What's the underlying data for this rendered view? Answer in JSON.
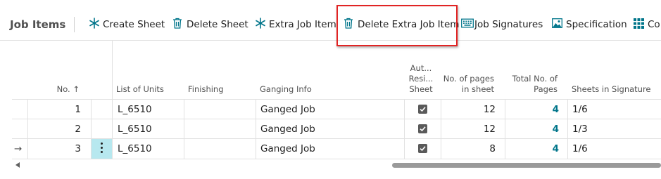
{
  "toolbar": {
    "title": "Job Items",
    "buttons": [
      {
        "label": "Create Sheet",
        "icon": "asterisk-icon"
      },
      {
        "label": "Delete Sheet",
        "icon": "trash-icon"
      },
      {
        "label": "Extra Job Item",
        "icon": "asterisk-icon"
      },
      {
        "label": "Delete Extra Job Item",
        "icon": "trash-icon"
      },
      {
        "label": "Job Signatures",
        "icon": "keyboard-icon"
      },
      {
        "label": "Specification",
        "icon": "image-icon"
      },
      {
        "label": "Co",
        "icon": "grid-icon"
      }
    ]
  },
  "table": {
    "headers": {
      "no": "No. ↑",
      "list_of_units": "List of Units",
      "finishing": "Finishing",
      "ganging_info": "Ganging Info",
      "auto_resize_1": "Aut...",
      "auto_resize_2": "Resi...",
      "auto_resize_3": "Sheet",
      "pages_in_sheet_1": "No. of pages",
      "pages_in_sheet_2": "in sheet",
      "total_pages_1": "Total No. of",
      "total_pages_2": "Pages",
      "sheets_in_signature": "Sheets in Signature"
    },
    "rows": [
      {
        "no": "1",
        "unit": "L_6510",
        "finishing": "",
        "ganging": "Ganged Job",
        "auto_resize": true,
        "pages_in_sheet": "12",
        "total_pages": "4",
        "sheets_in_signature": "1/6"
      },
      {
        "no": "2",
        "unit": "L_6510",
        "finishing": "",
        "ganging": "Ganged Job",
        "auto_resize": true,
        "pages_in_sheet": "12",
        "total_pages": "4",
        "sheets_in_signature": "1/3"
      },
      {
        "no": "3",
        "unit": "L_6510",
        "finishing": "",
        "ganging": "Ganged Job",
        "auto_resize": true,
        "pages_in_sheet": "8",
        "total_pages": "4",
        "sheets_in_signature": "1/6"
      }
    ],
    "current_row_marker": "→"
  },
  "colors": {
    "accent": "#00758a",
    "highlight_border": "#e12424",
    "selected_cell": "#b7e8ef"
  }
}
